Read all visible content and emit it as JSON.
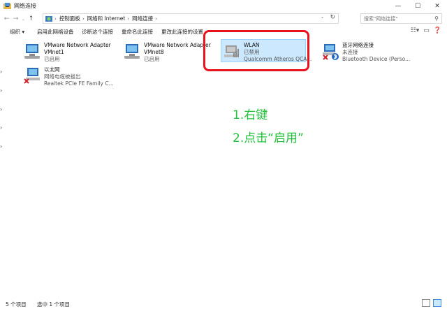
{
  "window": {
    "title": "网络连接",
    "controls": {
      "minimize": "—",
      "maximize": "☐",
      "close": "✕"
    }
  },
  "nav": {
    "back": "←",
    "forward": "→",
    "recent": "⌄",
    "up": "↑"
  },
  "address": {
    "crumbs": [
      "控制面板",
      "网络和 Internet",
      "网络连接"
    ],
    "separator": "›",
    "dropdown": "⌄",
    "refresh": "↻"
  },
  "search": {
    "placeholder": "搜索\"网络连接\"",
    "icon": "search-icon"
  },
  "toolbar": {
    "organize": "组织 ▾",
    "enable_device": "启用此网络设备",
    "diagnose": "诊断这个连接",
    "rename": "重命名此连接",
    "change_settings": "更改此连接的设置"
  },
  "connections": [
    {
      "name": "VMware Network Adapter",
      "line2": "VMnet1",
      "line3": "已启用"
    },
    {
      "name": "VMware Network Adapter",
      "line2": "VMnet8",
      "line3": "已启用"
    },
    {
      "name": "WLAN",
      "line2": "已禁用",
      "line3": "Qualcomm Atheros QCA..."
    },
    {
      "name": "蓝牙网络连接",
      "line2": "未连接",
      "line3": "Bluetooth Device (Perso..."
    },
    {
      "name": "以太网",
      "line2": "网络电缆被拔出",
      "line3": "Realtek PCIe FE Family C..."
    }
  ],
  "annotations": {
    "step1": "1.右键",
    "step2": "2.点击“启用”"
  },
  "status": {
    "items_count": "5 个项目",
    "selected_count": "选中 1 个项目"
  },
  "colors": {
    "selection": "#cce8ff",
    "red_box": "#e8131f",
    "annotation_green": "#23c13b"
  }
}
